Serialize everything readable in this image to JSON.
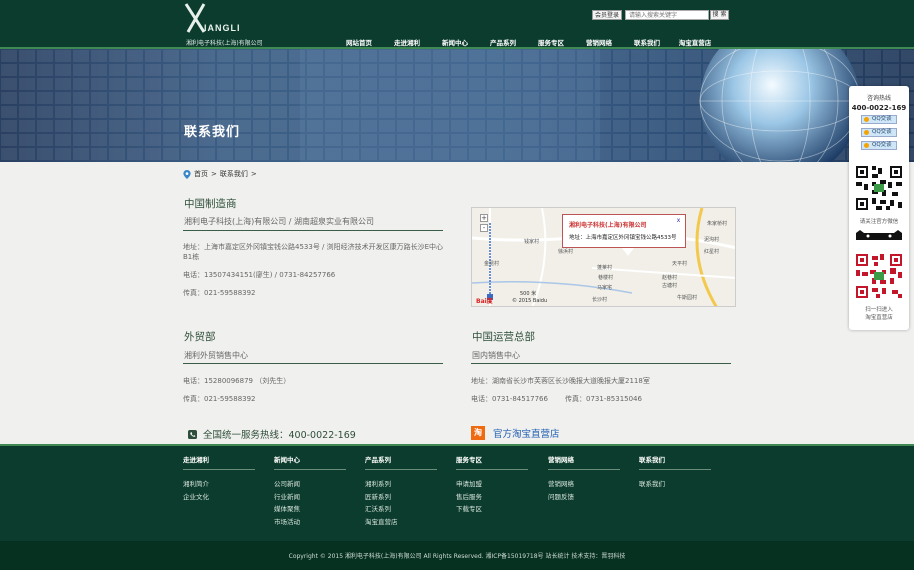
{
  "colors": {
    "header_bg": "#0b3c2d",
    "accent_green": "#3f8a52",
    "text_dark_green": "#2e4e3a",
    "link_blue": "#1e5eb4",
    "taobao_orange": "#f06a0f"
  },
  "header": {
    "logo_word": "IANGLI",
    "logo_sub": "湘利电子科技(上海)有限公司",
    "member_login": "会员登录",
    "search_placeholder": "请输入搜索关键字",
    "search_button": "搜 索",
    "nav": [
      "网站首页",
      "走进湘利",
      "新闻中心",
      "产品系列",
      "服务专区",
      "营销网络",
      "联系我们",
      "淘宝直营店"
    ]
  },
  "banner": {
    "title": "联系我们"
  },
  "breadcrumb": {
    "home": "首页",
    "sep": ">",
    "current": "联系我们",
    "tail": ">"
  },
  "sections": {
    "china_made": {
      "title": "中国制造商",
      "subtitle": "湘利电子科技(上海)有限公司 / 湖南超泉实业有限公司",
      "address": "地址：上海市嘉定区外冈镇宝钱公路4533号 / 浏阳经济技术开发区康万路长沙E中心B1栋",
      "phone": "电话：13507434151(廖生) / 0731-84257766",
      "fax": "传真：021-59588392"
    },
    "trade": {
      "title": "外贸部",
      "subtitle": "湘利外贸销售中心",
      "phone": "电话：15280096879 （刘先生）",
      "fax": "传真：021-59588392"
    },
    "hq": {
      "title": "中国运营总部",
      "subtitle": "国内销售中心",
      "address": "地址：湖南省长沙市芙蓉区长沙晚报大道晚报大厦2118室",
      "phone": "电话：0731-84517766",
      "fax": "传真：0731-85315046"
    }
  },
  "map": {
    "popup_title": "湘利电子科技(上海)有限公司",
    "popup_address": "地址：上海市嘉定区外冈镇宝钱公路4533号",
    "close": "x",
    "zoom_in": "+",
    "zoom_out": "-",
    "scale": "500 米",
    "logo": "Bai度",
    "copyright": "© 2015 Baidu",
    "labels": [
      "朱家桥村",
      "钱家村",
      "泥沟村",
      "徐浜村",
      "红星村",
      "金昆村",
      "天平村",
      "蓬莱村",
      "赵巷村",
      "巷楼村",
      "古塘村",
      "马家宅",
      "长沙村",
      "牛斯园村"
    ]
  },
  "hotline": {
    "text": "全国统一服务热线：400-0022-169"
  },
  "taobao": {
    "icon": "淘",
    "text": "官方淘宝直营店"
  },
  "footer": {
    "columns": [
      {
        "title": "走进湘利",
        "links": [
          "湘利简介",
          "企业文化"
        ]
      },
      {
        "title": "新闻中心",
        "links": [
          "公司新闻",
          "行业新闻",
          "媒体聚焦",
          "市场活动"
        ]
      },
      {
        "title": "产品系列",
        "links": [
          "湘利系列",
          "匠新系列",
          "汇沃系列",
          "淘宝直营店"
        ]
      },
      {
        "title": "服务专区",
        "links": [
          "申请加盟",
          "售后服务",
          "下载专区"
        ]
      },
      {
        "title": "营销网络",
        "links": [
          "营销网络",
          "问题反馈"
        ]
      },
      {
        "title": "联系我们",
        "links": [
          "联系我们"
        ]
      }
    ],
    "copyright": "Copyright © 2015 湘利电子科技(上海)有限公司 All Rights Reserved. 湘ICP备15019718号 站长统计 技术支持：晋羽科技"
  },
  "side_float": {
    "title": "咨询热线",
    "phone": "400-0022-169",
    "qq_buttons": [
      "QQ交谈",
      "QQ交谈",
      "QQ交谈"
    ],
    "wechat_note": "请关注官方微信",
    "taobao_note_1": "扫一扫进入",
    "taobao_note_2": "淘宝直营店"
  }
}
